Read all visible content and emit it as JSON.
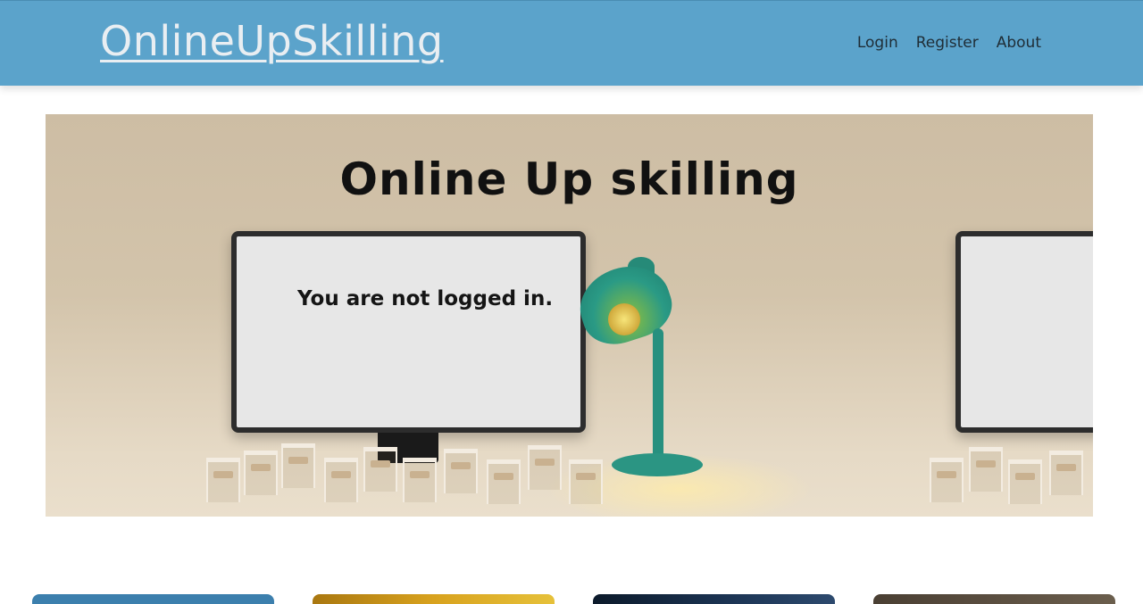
{
  "header": {
    "brand": "OnlineUpSkilling",
    "nav": [
      {
        "label": "Login"
      },
      {
        "label": "Register"
      },
      {
        "label": "About"
      }
    ]
  },
  "hero": {
    "title": "Online Up skilling",
    "status_message": "You are not logged in."
  },
  "colors": {
    "header_bg": "#5ba3cb",
    "brand_text": "#e9eef2",
    "hero_bg": "#cdbda4",
    "card_1": "#3c7fad",
    "card_2": "#d8a21e",
    "card_3": "#1d3656",
    "card_4": "#6b5e4d"
  }
}
